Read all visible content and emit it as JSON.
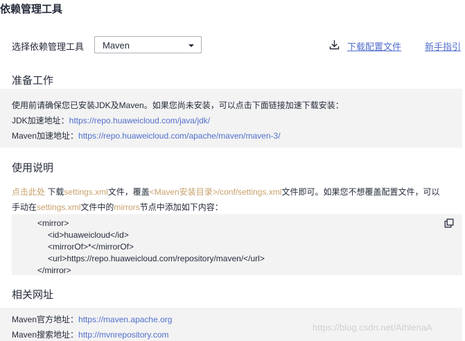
{
  "page_title": "依赖管理工具",
  "tool_selector": {
    "label": "选择依赖管理工具",
    "selected": "Maven"
  },
  "actions": {
    "download_config": "下载配置文件",
    "guide": "新手指引"
  },
  "prepare": {
    "title": "准备工作",
    "intro": "使用前请确保您已安装JDK及Maven。如果您尚未安装，可以点击下面链接加速下载安装：",
    "jdk_label": "JDK加速地址：",
    "jdk_url": "https://repo.huaweicloud.com/java/jdk/",
    "maven_label": "Maven加速地址：",
    "maven_url": "https://repo.huaweicloud.com/apache/maven/maven-3/"
  },
  "usage": {
    "title": "使用说明",
    "click_here": "点击此处",
    "t1": " 下载",
    "settings1": "settings.xml",
    "t2": "文件，覆盖",
    "path": "<Maven安装目录>/conf/settings.xml",
    "t3": "文件即可。如果您不想覆盖配置文件，可以",
    "t4": "手动在",
    "settings2": "settings.xml",
    "t5": "文件中的",
    "mirrors": "mirrors",
    "t6": "节点中添加如下内容："
  },
  "code_lines": [
    "<mirror>",
    "<id>huaweicloud</id>",
    "<mirrorOf>*</mirrorOf>",
    "<url>https://repo.huaweicloud.com/repository/maven/</url>",
    "</mirror>"
  ],
  "related": {
    "title": "相关网址",
    "official_label": "Maven官方地址：",
    "official_url": "https://maven.apache.org",
    "search_label": "Maven搜索地址：",
    "search_url": "http://mvnrepository.com"
  },
  "watermark": "https://blog.csdn.net/AthlenaA",
  "colors": {
    "link": "#526ecc",
    "highlight": "#c7a06a",
    "panel_bg": "#f3f3f3",
    "text": "#252b3a"
  },
  "icons": {
    "download": "download-icon",
    "dropdown": "chevron-down-icon",
    "copy": "copy-icon"
  }
}
